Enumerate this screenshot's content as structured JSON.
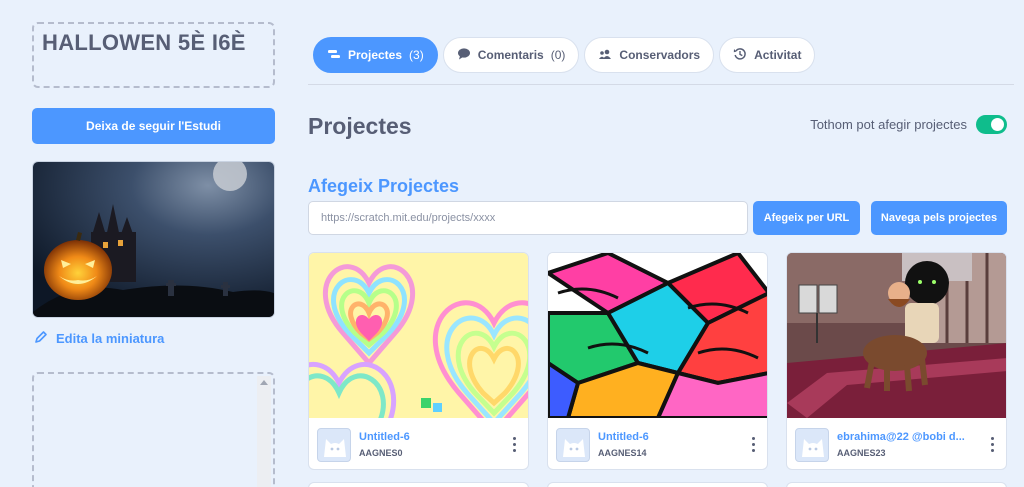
{
  "studio": {
    "title": "HALLOWEN 5È I6È",
    "follow_label": "Deixa de seguir l'Estudi",
    "edit_thumbnail_label": "Edita la miniatura"
  },
  "tabs": [
    {
      "label": "Projectes",
      "count": "(3)",
      "icon": "projects-icon",
      "active": true
    },
    {
      "label": "Comentaris",
      "count": "(0)",
      "icon": "comment-icon",
      "active": false
    },
    {
      "label": "Conservadors",
      "count": "",
      "icon": "curators-icon",
      "active": false
    },
    {
      "label": "Activitat",
      "count": "",
      "icon": "activity-icon",
      "active": false
    }
  ],
  "projects_section": {
    "heading": "Projectes",
    "toggle_label": "Tothom pot afegir projectes",
    "toggle_on": true,
    "add_heading": "Afegeix Projectes",
    "url_placeholder": "https://scratch.mit.edu/projects/xxxx",
    "add_by_url_label": "Afegeix per URL",
    "browse_label": "Navega pels projectes"
  },
  "projects": [
    {
      "title": "Untitled-6",
      "author": "AAGNES0"
    },
    {
      "title": "Untitled-6",
      "author": "AAGNES14"
    },
    {
      "title": "ebrahima@22 @bobi d...",
      "author": "AAGNES23"
    }
  ],
  "colors": {
    "accent": "#4c97ff",
    "toggle": "#0fbd8c",
    "background": "#e9f1fc",
    "text": "#575e75"
  }
}
